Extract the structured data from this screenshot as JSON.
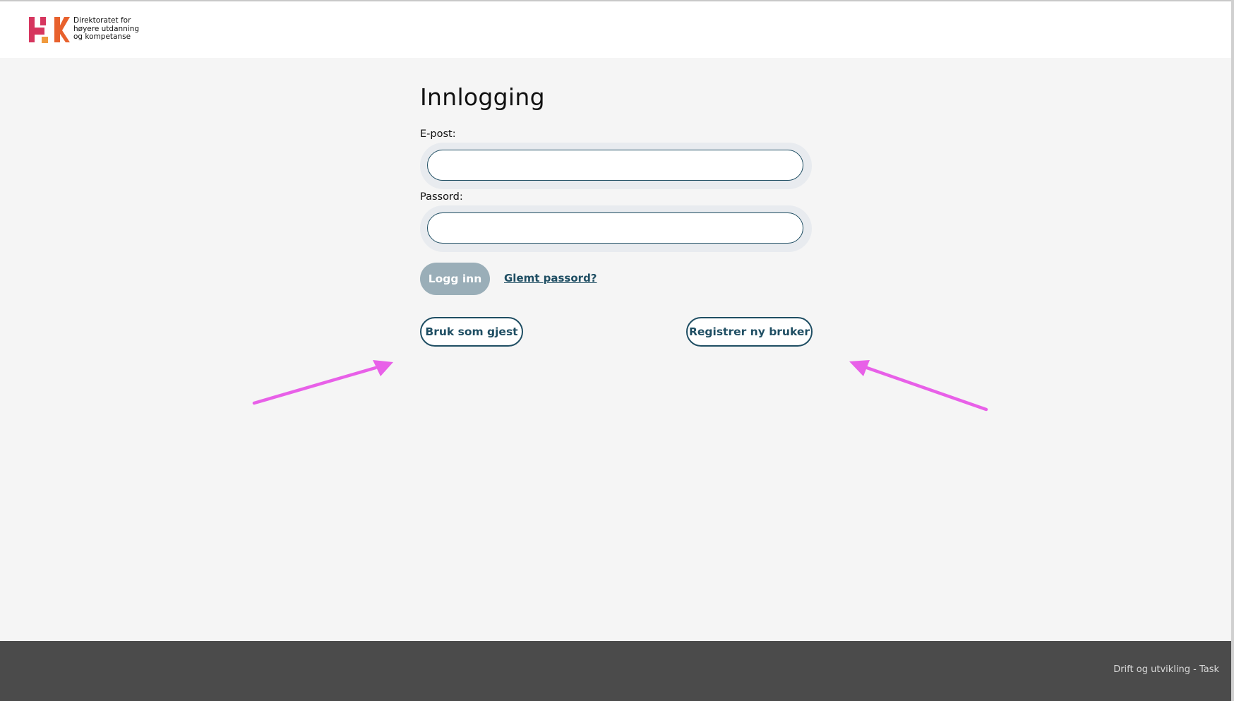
{
  "header": {
    "logo_text": "Direktoratet for\nhøyere utdanning\nog kompetanse"
  },
  "login": {
    "title": "Innlogging",
    "email_label": "E-post:",
    "email_value": "",
    "password_label": "Passord:",
    "password_value": "",
    "login_button": "Logg inn",
    "forgot_link": "Glemt passord?",
    "guest_button": "Bruk som gjest",
    "register_button": "Registrer ny bruker"
  },
  "annotations": {
    "arrow_color": "#e860e8"
  },
  "footer": {
    "text": "Drift og utvikling - Task"
  },
  "colors": {
    "accent": "#1f4e63",
    "login_button_bg": "#9aaeb8",
    "page_bg": "#f5f5f5",
    "footer_bg": "#4b4b4b"
  }
}
